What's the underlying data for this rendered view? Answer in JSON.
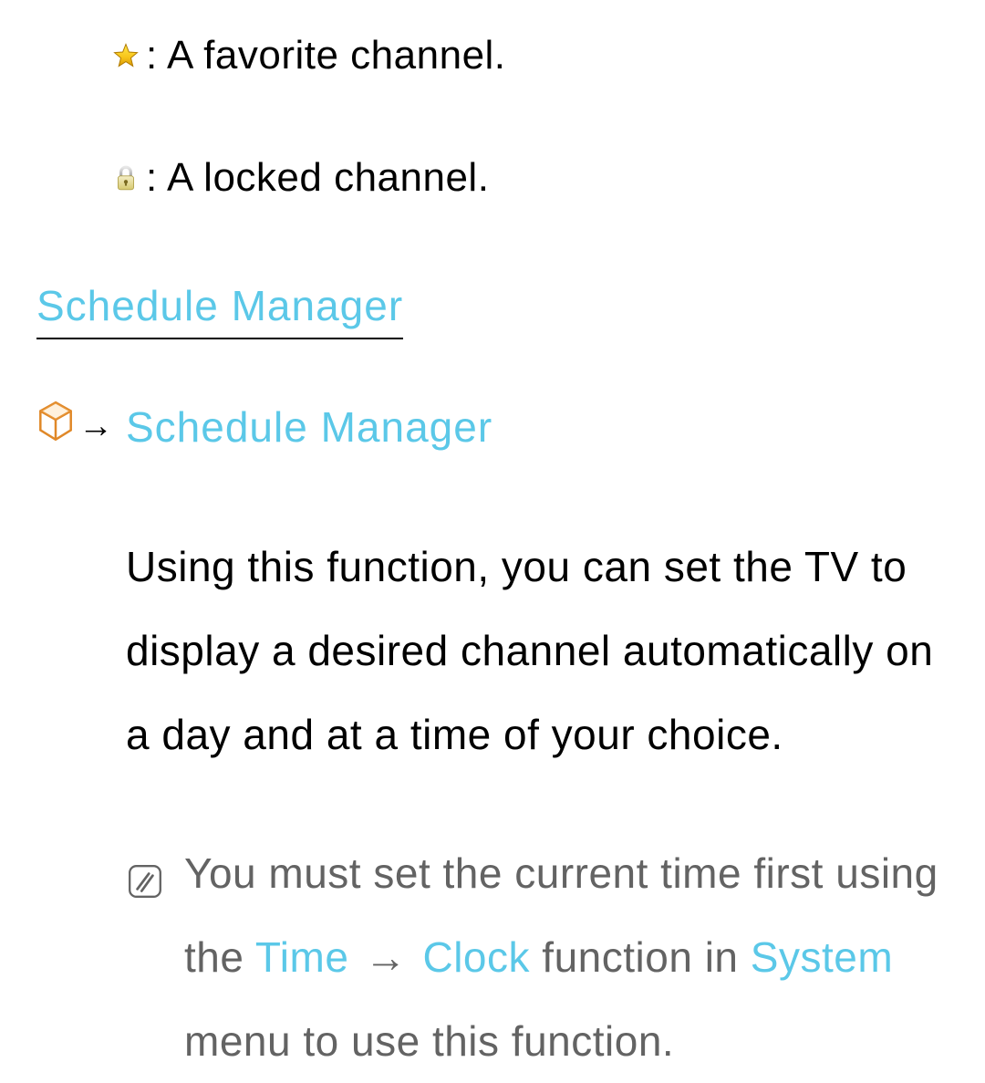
{
  "iconLines": {
    "favorite": ": A favorite channel.",
    "locked": ": A locked channel."
  },
  "section": {
    "heading": "Schedule Manager",
    "breadcrumb": "Schedule Manager",
    "body": "Using this function, you can set the TV to display a desired channel automatically on a day and at a time of your choice."
  },
  "note": {
    "part1": "You must set the current time first using the ",
    "time": "Time",
    "arrow": " → ",
    "clock": "Clock",
    "part2": " function in ",
    "system": "System",
    "part3": " menu to use this function."
  }
}
